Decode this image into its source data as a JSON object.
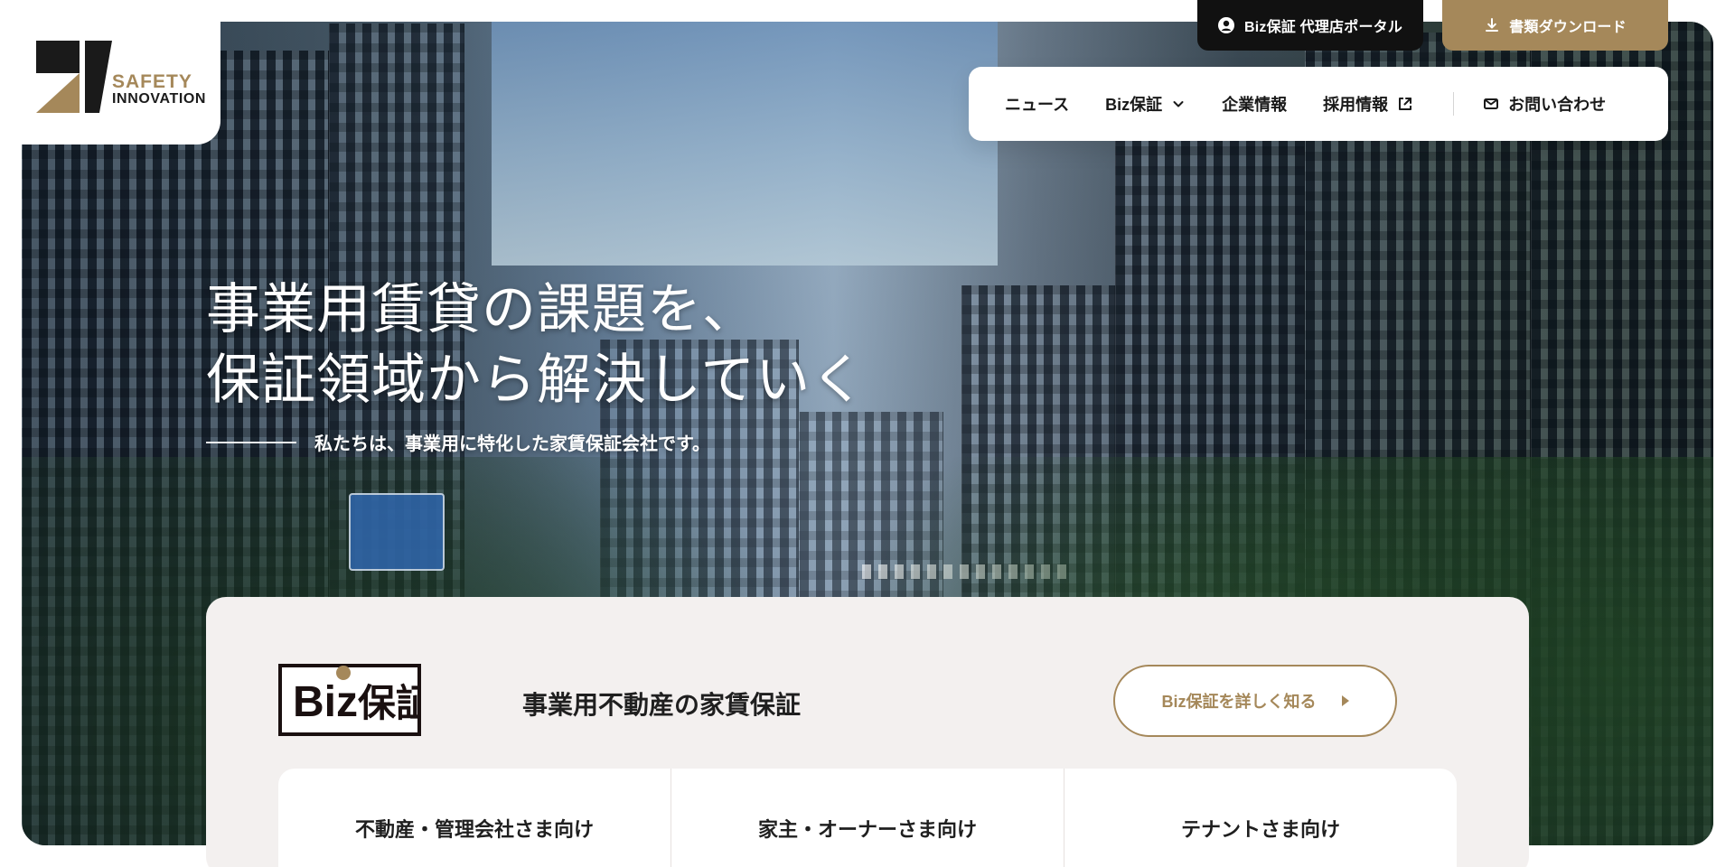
{
  "brand": {
    "logo_line1": "SAFETY",
    "logo_line2": "INNOVATION",
    "colors": {
      "gold": "#a5885a",
      "black": "#111111",
      "panel_bg": "#f3f0ef"
    }
  },
  "top_links": {
    "portal_label": "Biz保証 代理店ポータル",
    "download_label": "書類ダウンロード",
    "portal_icon": "user-circle-icon",
    "download_icon": "download-icon"
  },
  "nav": {
    "items": [
      {
        "label": "ニュース"
      },
      {
        "label": "Biz保証",
        "icon": "chevron-down-icon"
      },
      {
        "label": "企業情報"
      },
      {
        "label": "採用情報",
        "icon": "external-link-icon"
      }
    ],
    "contact_label": "お問い合わせ",
    "contact_icon": "mail-icon"
  },
  "hero": {
    "headline_line1": "事業用賃貸の課題を、",
    "headline_line2": "保証領域から解決していく",
    "subtitle": "私たちは、事業用に特化した家賃保証会社です。"
  },
  "biz": {
    "logo_text_left": "Biz",
    "logo_text_right": "保証",
    "title": "事業用不動産の家賃保証",
    "learn_more_label": "Biz保証を詳しく知る",
    "learn_more_icon": "triangle-right-icon"
  },
  "tabs": [
    {
      "label": "不動産・管理会社さま向け"
    },
    {
      "label": "家主・オーナーさま向け"
    },
    {
      "label": "テナントさま向け"
    }
  ]
}
